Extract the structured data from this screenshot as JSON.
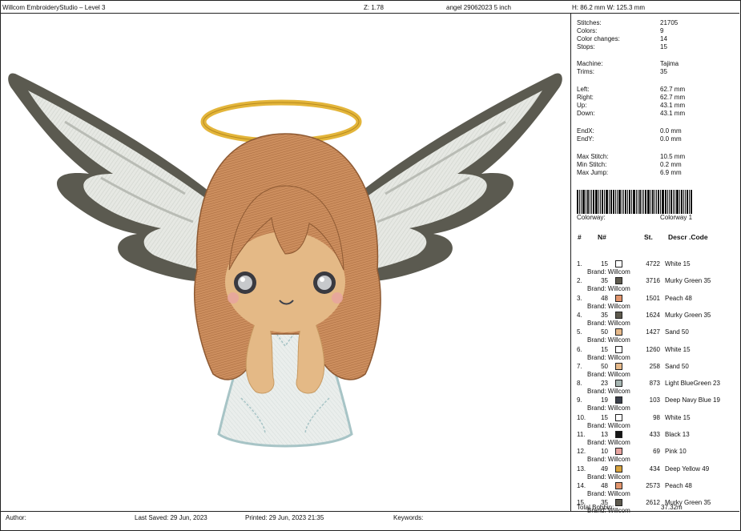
{
  "header": {
    "app_title": "Willcom EmbroideryStudio – Level 3",
    "zoom": "Z: 1.78",
    "file_name": "angel 29062023 5 inch",
    "size": "H: 86.2 mm   W: 125.3 mm"
  },
  "stats": [
    {
      "label": "Stitches:",
      "value": "21705"
    },
    {
      "label": "Colors:",
      "value": "9"
    },
    {
      "label": "Color changes:",
      "value": "14"
    },
    {
      "label": "Stops:",
      "value": "15"
    },
    {
      "label": "Machine:",
      "value": "Tajima"
    },
    {
      "label": "Trims:",
      "value": "35"
    },
    {
      "label": "Left:",
      "value": "62.7 mm"
    },
    {
      "label": "Right:",
      "value": "62.7 mm"
    },
    {
      "label": "Up:",
      "value": "43.1 mm"
    },
    {
      "label": "Down:",
      "value": "43.1 mm"
    },
    {
      "label": "EndX:",
      "value": "0.0 mm"
    },
    {
      "label": "EndY:",
      "value": "0.0 mm"
    },
    {
      "label": "Max Stitch:",
      "value": "10.5 mm"
    },
    {
      "label": "Min Stitch:",
      "value": "0.2 mm"
    },
    {
      "label": "Max Jump:",
      "value": "6.9 mm"
    }
  ],
  "colorway": {
    "label": "Colorway:",
    "value": "Colorway 1"
  },
  "table_headers": {
    "idx": "#",
    "num": "N#",
    "st": "St.",
    "desc": "Descr .Code"
  },
  "color_rows": [
    {
      "idx": "1.",
      "num": "15",
      "color": "#ffffff",
      "st": "4722",
      "desc": "White 15",
      "brand": "Brand: Willcom"
    },
    {
      "idx": "2.",
      "num": "35",
      "color": "#5e5a4e",
      "st": "3716",
      "desc": "Murky Green 35",
      "brand": "Brand: Willcom"
    },
    {
      "idx": "3.",
      "num": "48",
      "color": "#e2956d",
      "st": "1501",
      "desc": "Peach 48",
      "brand": "Brand: Willcom"
    },
    {
      "idx": "4.",
      "num": "35",
      "color": "#5e5a4e",
      "st": "1624",
      "desc": "Murky Green 35",
      "brand": "Brand: Willcom"
    },
    {
      "idx": "5.",
      "num": "50",
      "color": "#e6b98a",
      "st": "1427",
      "desc": "Sand 50",
      "brand": "Brand: Willcom"
    },
    {
      "idx": "6.",
      "num": "15",
      "color": "#ffffff",
      "st": "1260",
      "desc": "White 15",
      "brand": "Brand: Willcom"
    },
    {
      "idx": "7.",
      "num": "50",
      "color": "#e6b98a",
      "st": "258",
      "desc": "Sand 50",
      "brand": "Brand: Willcom"
    },
    {
      "idx": "8.",
      "num": "23",
      "color": "#a7b6b2",
      "st": "873",
      "desc": "Light BlueGreen 23",
      "brand": "Brand: Willcom"
    },
    {
      "idx": "9.",
      "num": "19",
      "color": "#3b3f4a",
      "st": "103",
      "desc": "Deep Navy Blue 19",
      "brand": "Brand: Willcom"
    },
    {
      "idx": "10.",
      "num": "15",
      "color": "#ffffff",
      "st": "98",
      "desc": "White 15",
      "brand": "Brand: Willcom"
    },
    {
      "idx": "11.",
      "num": "13",
      "color": "#161616",
      "st": "433",
      "desc": "Black 13",
      "brand": "Brand: Willcom"
    },
    {
      "idx": "12.",
      "num": "10",
      "color": "#e7a4a0",
      "st": "69",
      "desc": "Pink 10",
      "brand": "Brand: Willcom"
    },
    {
      "idx": "13.",
      "num": "49",
      "color": "#d8a33e",
      "st": "434",
      "desc": "Deep Yellow 49",
      "brand": "Brand: Willcom"
    },
    {
      "idx": "14.",
      "num": "48",
      "color": "#e2956d",
      "st": "2573",
      "desc": "Peach 48",
      "brand": "Brand: Willcom"
    },
    {
      "idx": "15.",
      "num": "35",
      "color": "#5e5a4e",
      "st": "2612",
      "desc": "Murky Green 35",
      "brand": "Brand: Willcom"
    }
  ],
  "total_bobbin": {
    "label": "Total Bobbin:",
    "value": "37.32m"
  },
  "footer": {
    "author": "Author:",
    "last_saved": "Last Saved: 29 Jun, 2023",
    "printed": "Printed: 29 Jun, 2023 21:35",
    "keywords": "Keywords:"
  },
  "colors": {
    "wing_outline": "#5b5a50",
    "wing_fill": "#e4e6e1",
    "hair": "#c98a5a",
    "skin": "#e4b986",
    "halo": "#e3b53a",
    "dress": "#e7ecea",
    "dress_outline": "#a7c4c6"
  }
}
